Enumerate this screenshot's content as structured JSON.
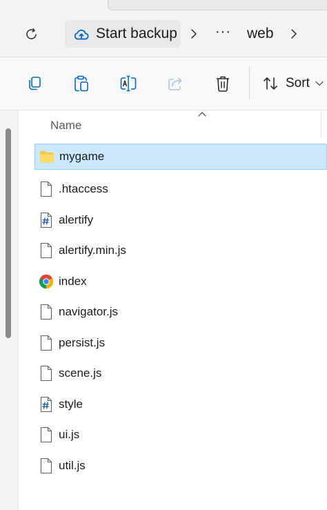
{
  "address_bar": {
    "refresh_icon": "refresh-icon",
    "breadcrumbs": [
      {
        "label": "Start backup",
        "icon": "cloud-backup-icon"
      },
      {
        "label": "···"
      },
      {
        "label": "web"
      }
    ]
  },
  "toolbar": {
    "buttons": [
      {
        "name": "copy",
        "icon": "copy-icon"
      },
      {
        "name": "paste",
        "icon": "paste-icon"
      },
      {
        "name": "rename",
        "icon": "rename-icon"
      },
      {
        "name": "share",
        "icon": "share-icon",
        "disabled": true
      },
      {
        "name": "delete",
        "icon": "delete-icon"
      }
    ],
    "sort_label": "Sort"
  },
  "file_list": {
    "column_header": "Name",
    "items": [
      {
        "name": "mygame",
        "type": "folder",
        "icon": "folder-icon",
        "selected": true
      },
      {
        "name": ".htaccess",
        "type": "file",
        "icon": "file-icon"
      },
      {
        "name": "alertify",
        "type": "css",
        "icon": "css-file-icon"
      },
      {
        "name": "alertify.min.js",
        "type": "file",
        "icon": "file-icon"
      },
      {
        "name": "index",
        "type": "html",
        "icon": "chrome-icon"
      },
      {
        "name": "navigator.js",
        "type": "file",
        "icon": "file-icon"
      },
      {
        "name": "persist.js",
        "type": "file",
        "icon": "file-icon"
      },
      {
        "name": "scene.js",
        "type": "file",
        "icon": "file-icon"
      },
      {
        "name": "style",
        "type": "css",
        "icon": "css-file-icon"
      },
      {
        "name": "ui.js",
        "type": "file",
        "icon": "file-icon"
      },
      {
        "name": "util.js",
        "type": "file",
        "icon": "file-icon"
      }
    ]
  },
  "colors": {
    "selection_bg": "#cce8ff",
    "selection_border": "#99d1ff",
    "accent": "#0067c0"
  }
}
